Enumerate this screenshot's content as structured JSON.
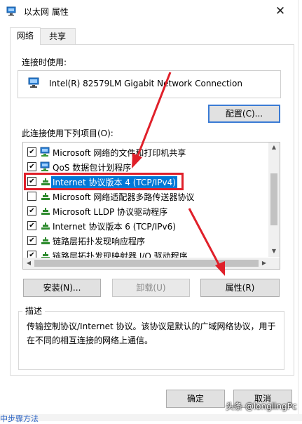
{
  "window": {
    "title": "以太网 属性",
    "close_glyph": "✕"
  },
  "tabs": [
    {
      "label": "网络",
      "active": true
    },
    {
      "label": "共享",
      "active": false
    }
  ],
  "connect_using_label": "连接时使用:",
  "adapter_name": "Intel(R) 82579LM Gigabit Network Connection",
  "configure_button": "配置(C)...",
  "items_label": "此连接使用下列项目(O):",
  "items": [
    {
      "checked": true,
      "icon": "network-client-icon",
      "label": "Microsoft 网络的文件和打印机共享",
      "selected": false
    },
    {
      "checked": true,
      "icon": "network-client-icon",
      "label": "QoS 数据包计划程序",
      "selected": false
    },
    {
      "checked": true,
      "icon": "protocol-icon",
      "label": "Internet 协议版本 4 (TCP/IPv4)",
      "selected": true
    },
    {
      "checked": false,
      "icon": "protocol-icon",
      "label": "Microsoft 网络适配器多路传送器协议",
      "selected": false
    },
    {
      "checked": true,
      "icon": "protocol-icon",
      "label": "Microsoft LLDP 协议驱动程序",
      "selected": false
    },
    {
      "checked": true,
      "icon": "protocol-icon",
      "label": "Internet 协议版本 6 (TCP/IPv6)",
      "selected": false
    },
    {
      "checked": true,
      "icon": "protocol-icon",
      "label": "链路层拓扑发现响应程序",
      "selected": false
    },
    {
      "checked": true,
      "icon": "protocol-icon",
      "label": "链路层拓扑发现映射器 I/O 驱动程序",
      "selected": false
    }
  ],
  "buttons": {
    "install": "安装(N)...",
    "uninstall": "卸载(U)",
    "properties": "属性(R)",
    "ok": "确定",
    "cancel": "取消"
  },
  "description_title": "描述",
  "description_text": "传输控制协议/Internet 协议。该协议是默认的广域网络协议，用于在不同的相互连接的网络上通信。",
  "watermark": "头条 @longlingPc",
  "bottom_partial_text": "中步骤方法",
  "colors": {
    "accent": "#0078d7",
    "annotation_red": "#e0202a"
  }
}
